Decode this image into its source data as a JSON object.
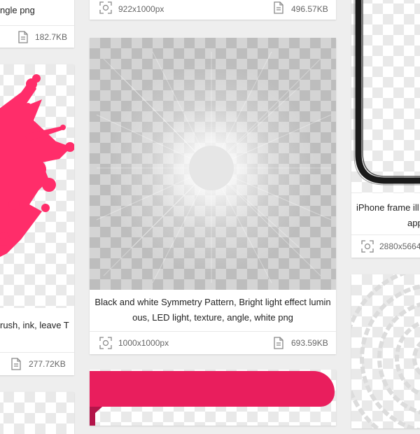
{
  "cards": {
    "left_top": {
      "title_fragment": "ngle png",
      "size": "182.7KB"
    },
    "left_mid": {
      "title_fragment": "rush, ink, leave T",
      "size": "277.72KB"
    },
    "center_top": {
      "dimensions": "922x1000px",
      "size": "496.57KB"
    },
    "center_main": {
      "title_line1": "Black and white Symmetry Pattern, Bright light effect lumin",
      "title_line2": "ous, LED light, texture, angle, white png",
      "dimensions": "1000x1000px",
      "size": "693.59KB"
    },
    "right_top": {
      "title_line1": "iPhone frame ill",
      "title_line2": "app",
      "dimensions": "2880x5664"
    }
  },
  "icons": [
    "file-icon",
    "fullscreen-icon"
  ],
  "colors": {
    "pink": "#ff2d6a",
    "banner": "#e91e5d",
    "checker_light": "#e9e9e9",
    "checker_dark": "#bdbdbd"
  }
}
